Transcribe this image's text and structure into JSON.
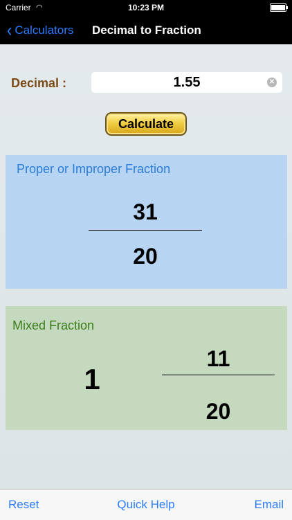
{
  "status_bar": {
    "carrier": "Carrier",
    "wifi_icon": "wifi-icon",
    "time": "10:23 PM",
    "battery_icon": "battery-icon"
  },
  "nav": {
    "back_label": "Calculators",
    "back_icon": "chevron-left-icon",
    "title": "Decimal to Fraction"
  },
  "input": {
    "label": "Decimal :",
    "value": "1.55",
    "clear_icon": "clear-icon"
  },
  "calculate_label": "Calculate",
  "proper_fraction": {
    "title": "Proper or Improper Fraction",
    "numerator": "31",
    "denominator": "20"
  },
  "mixed_fraction": {
    "title": "Mixed Fraction",
    "whole": "1",
    "numerator": "11",
    "denominator": "20"
  },
  "toolbar": {
    "reset": "Reset",
    "quick_help": "Quick Help",
    "email": "Email"
  },
  "colors": {
    "accent": "#2a7cff",
    "proper_panel": "#b7d5f3",
    "mixed_panel": "#c4d9be",
    "label_brown": "#7a4b16",
    "button_gold": "#f1cf44"
  }
}
